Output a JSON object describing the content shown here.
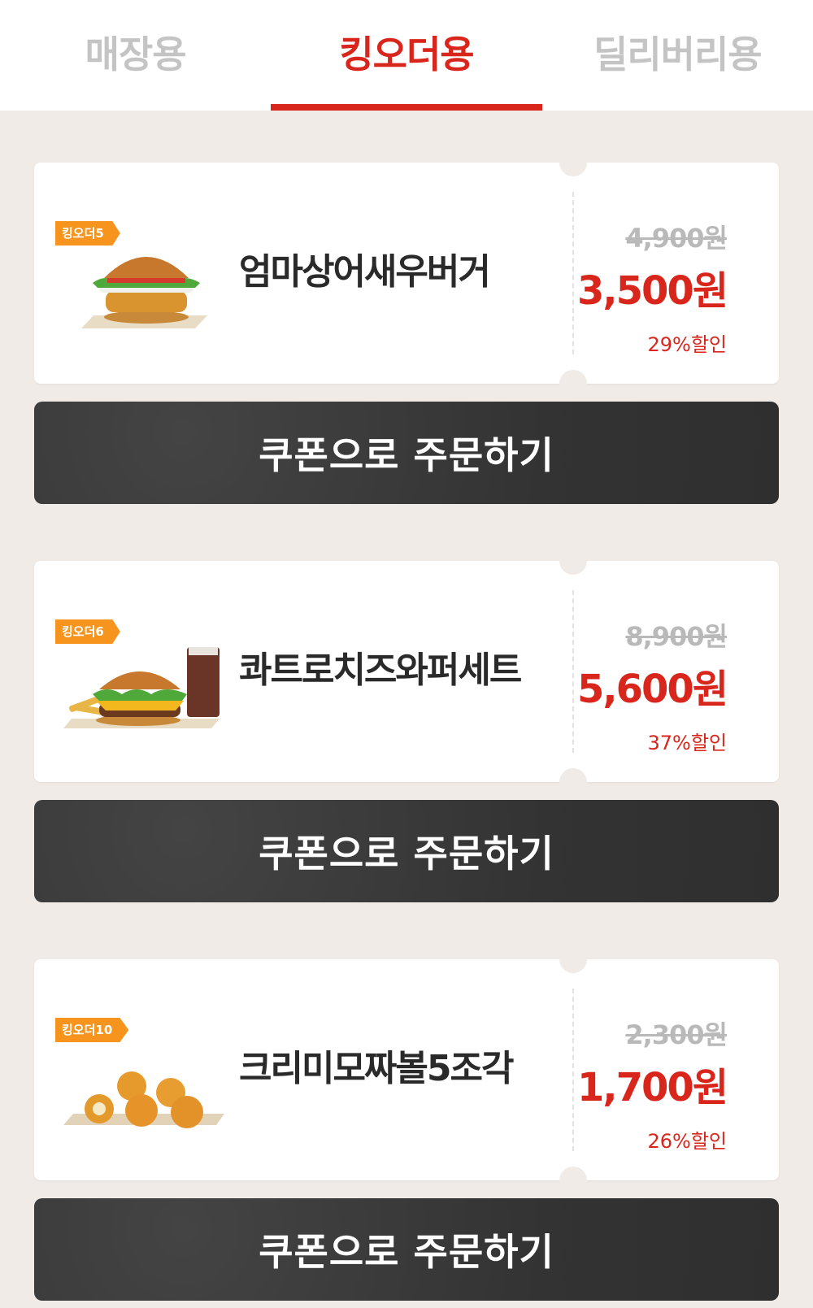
{
  "tabs": [
    {
      "label": "매장용",
      "active": false
    },
    {
      "label": "킹오더용",
      "active": true
    },
    {
      "label": "딜리버리용",
      "active": false
    }
  ],
  "coupons": [
    {
      "badge": "킹오더5",
      "image_icon": "burger-icon",
      "name": "엄마상어새우버거",
      "original_price": "4,900원",
      "sale_price": "3,500원",
      "discount": "29%할인",
      "button_label": "쿠폰으로 주문하기"
    },
    {
      "badge": "킹오더6",
      "image_icon": "burger-set-icon",
      "name": "콰트로치즈와퍼세트",
      "original_price": "8,900원",
      "sale_price": "5,600원",
      "discount": "37%할인",
      "button_label": "쿠폰으로 주문하기"
    },
    {
      "badge": "킹오더10",
      "image_icon": "cheese-balls-icon",
      "name": "크리미모짜볼5조각",
      "original_price": "2,300원",
      "sale_price": "1,700원",
      "discount": "26%할인",
      "button_label": "쿠폰으로 주문하기"
    }
  ],
  "colors": {
    "accent": "#d9261c",
    "badge": "#f7941d",
    "background": "#f1ebe7",
    "button": "#3a3a3a"
  }
}
